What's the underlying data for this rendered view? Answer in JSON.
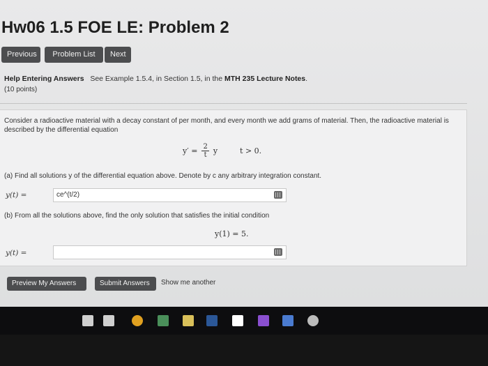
{
  "title": "Hw06 1.5 FOE LE: Problem 2",
  "nav": {
    "previous": "Previous",
    "problem_list": "Problem List",
    "next": "Next"
  },
  "help": {
    "heading": "Help Entering Answers",
    "text_pre": "See Example ",
    "example": "1.5.4",
    "text_mid": ", in Section ",
    "section": "1.5",
    "text_in": ", in the ",
    "notes": "MTH 235 Lecture Notes",
    "period": "."
  },
  "points": "(10 points)",
  "problem": {
    "intro": "Consider a radioactive material with a decay constant of per month, and every month we add grams of material. Then, the radioactive material is described by the differential equation",
    "eq_lhs": "y′ =",
    "eq_num": "2",
    "eq_den": "t",
    "eq_rhs": "y",
    "eq_cond": "t > 0.",
    "part_a": "(a) Find all solutions y of the differential equation above. Denote by c any arbitrary integration constant.",
    "label_a": "y(t) =",
    "answer_a": "ce^(t/2)",
    "part_b": "(b) From all the solutions above, find the only solution that satisfies the initial condition",
    "initial_condition": "y(1) = 5.",
    "label_b": "y(t) =",
    "answer_b": ""
  },
  "actions": {
    "preview": "Preview My Answers",
    "submit": "Submit Answers",
    "show_another": "Show me another"
  },
  "taskbar": {
    "icons": [
      "mic-icon",
      "task-view-icon",
      "chrome-icon",
      "photos-icon",
      "store-icon",
      "word-icon",
      "twitter-icon",
      "visual-studio-icon",
      "edit-icon",
      "settings-icon"
    ],
    "colors": [
      "#cfcfcf",
      "#cfcfcf",
      "#e0a020",
      "#4a8f5a",
      "#d9c05a",
      "#2b5797",
      "#ffffff",
      "#8a4fd0",
      "#4a7bd0",
      "#bbbbbb"
    ]
  }
}
